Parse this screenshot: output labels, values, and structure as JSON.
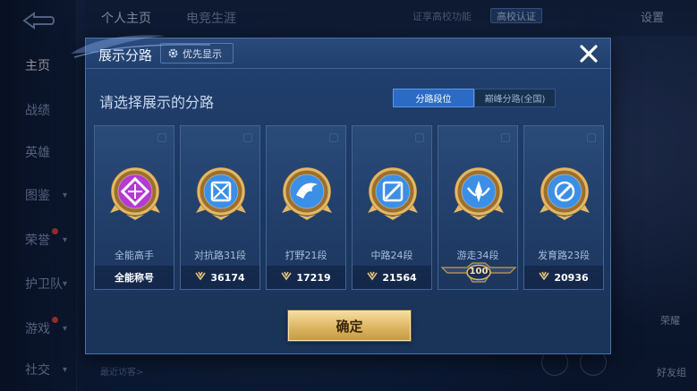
{
  "background": {
    "nav_items": [
      {
        "label": "主页",
        "active": true
      },
      {
        "label": "战绩"
      },
      {
        "label": "英雄"
      },
      {
        "label": "图鉴",
        "chevron": true
      },
      {
        "label": "荣誉",
        "chevron": true,
        "dot": true
      },
      {
        "label": "护卫队",
        "chevron": true
      },
      {
        "label": "游戏",
        "chevron": true,
        "dot": true
      },
      {
        "label": "社交",
        "chevron": true
      }
    ],
    "top_tabs": [
      "个人主页",
      "电竞生涯"
    ],
    "campus_prompt": "证享高校功能",
    "campus_badge": "高校认证",
    "settings": "设置",
    "visitors": "最近访客>",
    "right_labels": [
      "荣耀",
      "好友组"
    ]
  },
  "dialog": {
    "title": "展示分路",
    "priority_button": "优先显示",
    "subtitle": "请选择展示的分路",
    "toggle": {
      "active": "分路段位",
      "inactive": "巅峰分路(全国)"
    },
    "confirm": "确定",
    "cards": [
      {
        "name": "全能高手",
        "value": "全能称号",
        "emblem": "allround-emblem-icon",
        "color": "#b43ad0"
      },
      {
        "name": "对抗路31段",
        "value": "36174",
        "emblem": "clash-lane-emblem-icon",
        "color": "#3b8fe6"
      },
      {
        "name": "打野21段",
        "value": "17219",
        "emblem": "jungle-emblem-icon",
        "color": "#3b8fe6"
      },
      {
        "name": "中路24段",
        "value": "21564",
        "emblem": "mid-lane-emblem-icon",
        "color": "#3b8fe6"
      },
      {
        "name": "游走34段",
        "value": "100",
        "emblem": "roam-emblem-icon",
        "color": "#3b8fe6",
        "rank_frame": true
      },
      {
        "name": "发育路23段",
        "value": "20936",
        "emblem": "farm-lane-emblem-icon",
        "color": "#3b8fe6"
      }
    ]
  }
}
